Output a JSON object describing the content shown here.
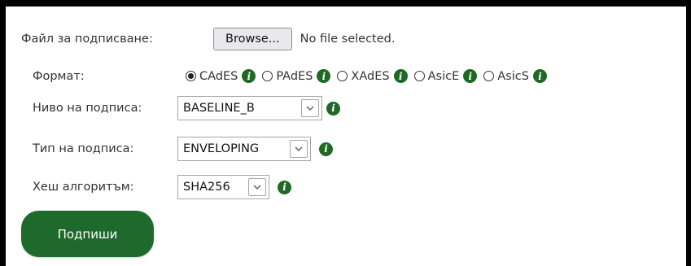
{
  "file": {
    "label": "Файл за подписване:",
    "button_label": "Browse...",
    "status": "No file selected."
  },
  "format": {
    "label": "Формат:",
    "selected": "CAdES",
    "options": [
      {
        "label": "CAdES",
        "checked": true
      },
      {
        "label": "PAdES",
        "checked": false
      },
      {
        "label": "XAdES",
        "checked": false
      },
      {
        "label": "AsicE",
        "checked": false
      },
      {
        "label": "AsicS",
        "checked": false
      }
    ]
  },
  "level": {
    "label": "Ниво на подписа:",
    "value": "BASELINE_B"
  },
  "type": {
    "label": "Тип на подписа:",
    "value": "ENVELOPING"
  },
  "hash": {
    "label": "Хеш алгоритъм:",
    "value": "SHA256"
  },
  "submit": {
    "label": "Подпиши"
  },
  "icons": {
    "info": "info-icon",
    "info_glyph": "i",
    "chevron": "chevron-down-icon"
  },
  "colors": {
    "accent": "#1d6a2c",
    "info_bg": "#1e6a24",
    "frame": "#000000"
  }
}
